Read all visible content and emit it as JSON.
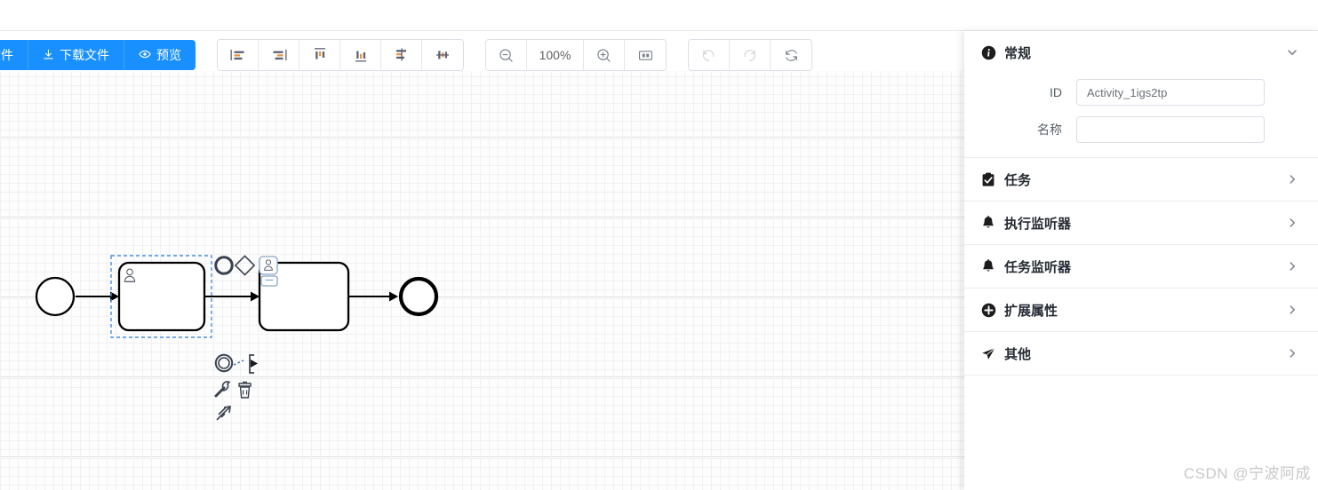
{
  "toolbar": {
    "file_buttons": [
      {
        "label": "开文件",
        "icon": "folder-open-icon",
        "truncated": true
      },
      {
        "label": "下载文件",
        "icon": "download-icon",
        "truncated": false
      },
      {
        "label": "预览",
        "icon": "eye-icon",
        "truncated": false
      }
    ],
    "align_buttons": [
      {
        "name": "align-left",
        "icon": "align-left-icon"
      },
      {
        "name": "align-right",
        "icon": "align-right-icon"
      },
      {
        "name": "align-top",
        "icon": "align-top-icon"
      },
      {
        "name": "align-bottom",
        "icon": "align-bottom-icon"
      },
      {
        "name": "align-center-horizontal",
        "icon": "align-center-horizontal-icon"
      },
      {
        "name": "align-center-vertical",
        "icon": "align-center-vertical-icon"
      }
    ],
    "zoom_group": {
      "zoom_out": "zoom-out-icon",
      "zoom_level": "100%",
      "zoom_in": "zoom-in-icon",
      "fit_viewport": "fit-viewport-icon"
    },
    "history_group": {
      "undo": "undo-icon",
      "redo": "redo-icon",
      "restore": "restore-icon"
    }
  },
  "canvas": {
    "zoom_percent": "100%",
    "elements": [
      {
        "type": "start-event",
        "name": "start-event"
      },
      {
        "type": "user-task",
        "name": "user-task-selected",
        "selected": true
      },
      {
        "type": "user-task",
        "name": "user-task-second",
        "selected": false
      },
      {
        "type": "end-event",
        "name": "end-event"
      }
    ],
    "context_pad": [
      {
        "name": "append-end-event",
        "icon": "circle-icon"
      },
      {
        "name": "append-gateway",
        "icon": "diamond-icon"
      },
      {
        "name": "append-task",
        "icon": "user-task-icon"
      },
      {
        "name": "append-intermediate-event",
        "icon": "double-circle-icon"
      },
      {
        "name": "append-text-annotation",
        "icon": "text-annotation-icon"
      },
      {
        "name": "change-type",
        "icon": "wrench-icon"
      },
      {
        "name": "delete",
        "icon": "trash-icon"
      },
      {
        "name": "connect",
        "icon": "connect-arrow-icon"
      }
    ]
  },
  "panel": {
    "sections": [
      {
        "id": "general",
        "title": "常规",
        "icon": "info-icon",
        "expanded": true,
        "chevron": "chevron-down-icon",
        "fields": [
          {
            "name": "id",
            "label": "ID",
            "value": "Activity_1igs2tp",
            "placeholder": ""
          },
          {
            "name": "name",
            "label": "名称",
            "value": "",
            "placeholder": ""
          }
        ]
      },
      {
        "id": "task",
        "title": "任务",
        "icon": "clipboard-check-icon",
        "expanded": false,
        "chevron": "chevron-right-icon"
      },
      {
        "id": "execution-listener",
        "title": "执行监听器",
        "icon": "bell-icon",
        "expanded": false,
        "chevron": "chevron-right-icon"
      },
      {
        "id": "task-listener",
        "title": "任务监听器",
        "icon": "bell-icon",
        "expanded": false,
        "chevron": "chevron-right-icon"
      },
      {
        "id": "extension-properties",
        "title": "扩展属性",
        "icon": "plus-circle-icon",
        "expanded": false,
        "chevron": "chevron-right-icon"
      },
      {
        "id": "other",
        "title": "其他",
        "icon": "send-icon",
        "expanded": false,
        "chevron": "chevron-right-icon"
      }
    ]
  },
  "watermark": {
    "text": "CSDN @宁波阿成"
  },
  "colors": {
    "primary": "#1890ff",
    "panel_text": "#262b33",
    "grid_minor": "#f1f1f1",
    "grid_major": "#e2e2e2",
    "selection": "#4a90e2"
  }
}
